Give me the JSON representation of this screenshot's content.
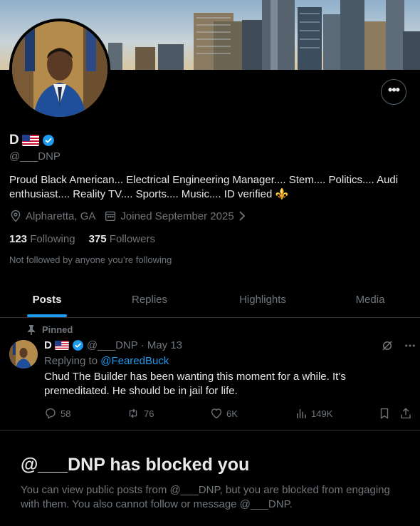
{
  "profile": {
    "name": "D",
    "handle": "@___DNP",
    "bio": "Proud Black American... Electrical Engineering Manager.... Stem.... Politics.... Audi enthusiast.... Reality TV.... Sports.... Music.... ID verified ⚜️",
    "location": "Alpharetta, GA",
    "joined": "Joined September 2025",
    "following_count": "123",
    "following_label": "Following",
    "followers_count": "375",
    "followers_label": "Followers",
    "not_followed": "Not followed by anyone you’re following"
  },
  "tabs": [
    {
      "label": "Posts"
    },
    {
      "label": "Replies"
    },
    {
      "label": "Highlights"
    },
    {
      "label": "Media"
    }
  ],
  "tweet": {
    "pinned_label": "Pinned",
    "name": "D",
    "handle_date": "@___DNP · May 13",
    "replying_prefix": "Replying to ",
    "replying_to": "@FearedBuck",
    "text": "Chud The Builder has been wanting this moment for a while. It’s premeditated. He should be in jail for life.",
    "replies": "58",
    "reposts": "76",
    "likes": "6K",
    "views": "149K"
  },
  "blocked": {
    "title": "@___DNP has blocked you",
    "description": "You can view public posts from @___DNP, but you are blocked from engaging with them. You also cannot follow or message @___DNP."
  },
  "colors": {
    "accent": "#1d9bf0",
    "muted": "#71767b",
    "border": "#2f3336",
    "background": "#000000"
  }
}
